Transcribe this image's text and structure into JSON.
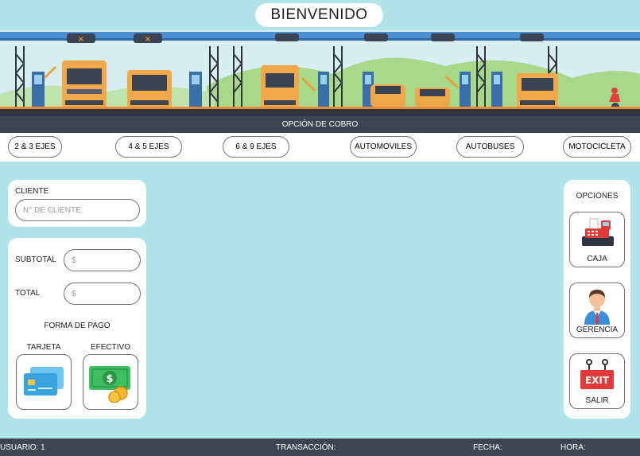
{
  "header": {
    "title": "BIENVENIDO"
  },
  "banner": {
    "section_label": "OPCIÓN DE COBRO"
  },
  "vehicles": [
    {
      "label": "2 & 3 EJES"
    },
    {
      "label": "4 & 5 EJES"
    },
    {
      "label": "6 & 9 EJES"
    },
    {
      "label": "AUTOMOVILES"
    },
    {
      "label": "AUTOBUSES"
    },
    {
      "label": "MOTOCICLETA"
    }
  ],
  "client": {
    "label": "CLIENTE",
    "placeholder": "N° DE CLIENTE"
  },
  "totals": {
    "subtotal_label": "SUBTOTAL",
    "subtotal_placeholder": "$",
    "total_label": "TOTAL",
    "total_placeholder": "$",
    "payment_title": "FORMA DE PAGO",
    "card_label": "TARJETA",
    "cash_label": "EFECTIVO"
  },
  "options": {
    "title": "OPCIONES",
    "caja": "CAJA",
    "gerencia": "GERENCIA",
    "salir": "SALIR",
    "exit_sign": "EXIT"
  },
  "status": {
    "usuario": "USUARIO: 1",
    "transaccion": "TRANSACCIÓN:",
    "fecha": "FECHA:",
    "hora": "HORA:"
  },
  "colors": {
    "background": "#b1e4e8",
    "dark_bar": "#3d4452",
    "truck_orange": "#f0a84a",
    "rail_blue": "#4a8fd0"
  }
}
